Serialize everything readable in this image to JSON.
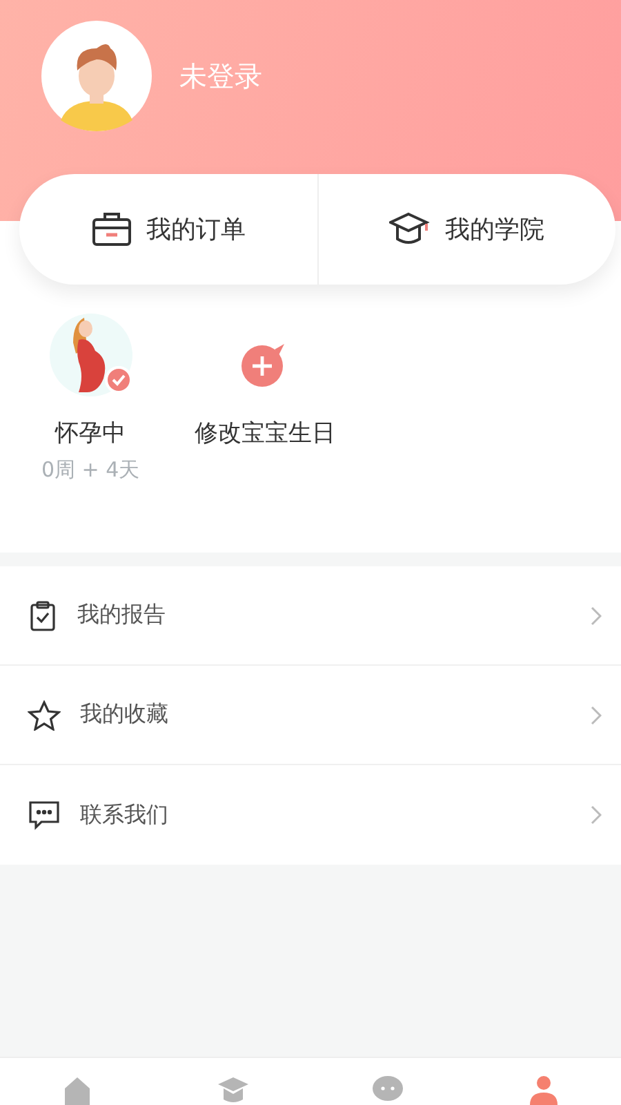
{
  "profile": {
    "name": "未登录"
  },
  "shortcuts": [
    {
      "label": "我的订单"
    },
    {
      "label": "我的学院"
    }
  ],
  "pregnancy": {
    "status": "怀孕中",
    "checked": true,
    "duration": "0周 + 4天",
    "action": "修改宝宝生日"
  },
  "menu": [
    {
      "label": "我的报告"
    },
    {
      "label": "我的收藏"
    },
    {
      "label": "联系我们"
    }
  ],
  "tabs": [
    {
      "selected": false
    },
    {
      "selected": false
    },
    {
      "selected": false
    },
    {
      "selected": true
    }
  ]
}
